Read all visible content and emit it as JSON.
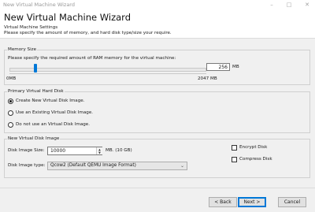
{
  "window": {
    "title": "New Virtual Machine Wizard",
    "controls": {
      "minimize": "–",
      "maximize": "□",
      "close": "✕"
    }
  },
  "header": {
    "title": "New Virtual Machine Wizard",
    "subtitle": "Virtual Machine Settings",
    "description": "Please specify the amount of memory, and hard disk type/size your require."
  },
  "memory": {
    "legend": "Memory Size",
    "prompt": "Please specify the required amount of RAM memory for the virtual machine:",
    "min_label": "0MB",
    "max_label": "2047 MB",
    "value": "256",
    "unit": "MB",
    "slider_fraction": 0.125
  },
  "primary_disk": {
    "legend": "Primary Virtual Hard Disk",
    "options": [
      {
        "label": "Create New Virtual Disk Image.",
        "selected": true
      },
      {
        "label": "Use an  Existing Virtual Disk Image.",
        "selected": false
      },
      {
        "label": "Do not use an Virtual Disk Image.",
        "selected": false
      }
    ]
  },
  "new_disk": {
    "legend": "New Virtual Disk Image",
    "size_label": "Disk Image Size:",
    "size_value": "10000",
    "size_unit": "MB. (10 GB)",
    "type_label": "Disk Image type:",
    "type_value": "Qcow2 (Default QEMU Image Format)",
    "encrypt_label": "Encrypt Disk",
    "encrypt_checked": false,
    "compress_label": "Compress Disk",
    "compress_checked": false
  },
  "footer": {
    "back_label": "< Back",
    "next_label": "Next >",
    "cancel_label": "Cancel"
  },
  "icons": {
    "chevron": "⌄",
    "spin_up": "▲",
    "spin_down": "▼"
  }
}
